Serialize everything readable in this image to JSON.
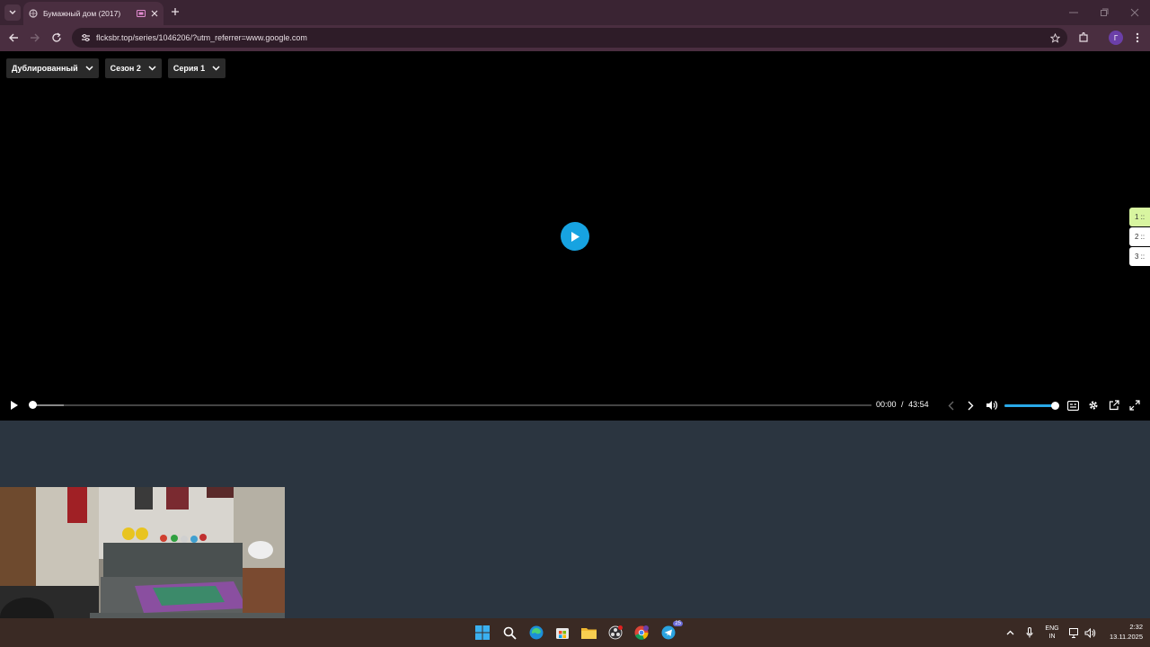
{
  "browser": {
    "tab": {
      "title": "Бумажный дом (2017)"
    },
    "url": "flcksbr.top/series/1046206/?utm_referrer=www.google.com",
    "profile_initial": "Г"
  },
  "player": {
    "dropdowns": [
      {
        "label": "Дублированный"
      },
      {
        "label": "Сезон 2"
      },
      {
        "label": "Серия 1"
      }
    ],
    "side_tabs": [
      "1 ::",
      "2 ::",
      "3 ::"
    ],
    "time_current": "00:00",
    "time_separator": "/",
    "time_total": "43:54",
    "progress_fraction": 0.0,
    "buffered_fraction": 0.04,
    "volume_fraction": 1.0,
    "accent_color": "#17a3e1"
  },
  "taskbar": {
    "icons": [
      "windows-start-icon",
      "search-icon",
      "edge-icon",
      "store-icon",
      "file-explorer-icon",
      "obs-icon",
      "chrome-icon",
      "telegram-icon"
    ],
    "telegram_badge": "25",
    "lang_top": "ENG",
    "lang_bottom": "IN",
    "time": "2:32",
    "date": "13.11.2025"
  }
}
